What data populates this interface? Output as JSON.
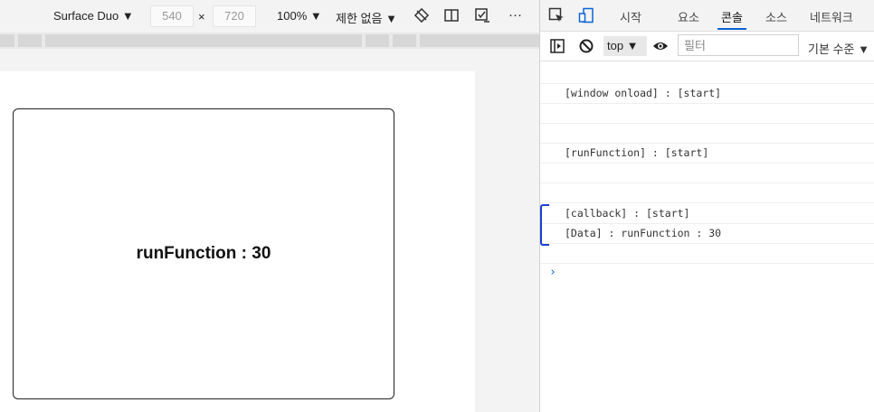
{
  "device_toolbar": {
    "device": "Surface Duo ▼",
    "width": "540",
    "times": "×",
    "height": "720",
    "zoom": "100% ▼",
    "throttle": "제한 없음 ▼",
    "more": "···"
  },
  "page": {
    "box_text": "runFunction : 30"
  },
  "devtools": {
    "tabs": [
      "시작",
      "요소",
      "콘솔",
      "소스",
      "네트워크"
    ],
    "active_tab": "콘솔",
    "console_toolbar": {
      "context": "top ▼",
      "filter_placeholder": "필터",
      "levels": "기본 수준 ▼"
    },
    "logs": [
      "[window onload] : [start]",
      "[runFunction] : [start]",
      "[callback] : [start]",
      "[Data] : runFunction : 30"
    ],
    "prompt": "›",
    "accent": "#0a64d8"
  }
}
